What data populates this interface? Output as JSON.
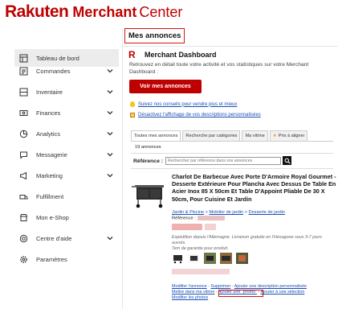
{
  "brand": {
    "rakuten": "Rakuten",
    "merchant": "Merchant",
    "center": "Center"
  },
  "sidebar": {
    "items": [
      {
        "label": "Tableau de bord",
        "icon": "dashboard-icon",
        "expandable": false,
        "active": true
      },
      {
        "label": "Commandes",
        "icon": "orders-icon",
        "expandable": true
      },
      {
        "label": "Inventaire",
        "icon": "inventory-icon",
        "expandable": true
      },
      {
        "label": "Finances",
        "icon": "finance-icon",
        "expandable": true
      },
      {
        "label": "Analytics",
        "icon": "analytics-icon",
        "expandable": true
      },
      {
        "label": "Messagerie",
        "icon": "message-icon",
        "expandable": true
      },
      {
        "label": "Marketing",
        "icon": "marketing-icon",
        "expandable": true
      },
      {
        "label": "Fulfillment",
        "icon": "fulfillment-icon",
        "expandable": false
      },
      {
        "label": "Mon e-Shop",
        "icon": "shop-icon",
        "expandable": false
      },
      {
        "label": "Centre d'aide",
        "icon": "help-icon",
        "expandable": true
      },
      {
        "label": "Paramètres",
        "icon": "settings-icon",
        "expandable": false
      }
    ]
  },
  "main": {
    "page_title": "Mes annonces",
    "dashboard_title": "Merchant Dashboard",
    "dashboard_description": "Retrouvez en détail toute votre activité et vos statistiques sur votre Merchant Dashboard :",
    "dashboard_button": "Voir mes annonces",
    "tips_link": "Suivez nos conseils pour vendre plus et mieux",
    "custom_desc_link": "Désactivez l'affichage de vos descriptions personnalisées",
    "tabs": [
      {
        "label": "Toutes mes annonces",
        "active": true
      },
      {
        "label": "Recherche par catégories"
      },
      {
        "label": "Ma vitrine"
      },
      {
        "label": "Prix à aligner",
        "icon": "star-icon"
      }
    ],
    "count_label": "19 annonces",
    "filter": {
      "label": "Référence :",
      "placeholder": "Rechercher par référence dans vos annonces"
    },
    "product": {
      "title": "Charlot De Barbecue Avec Porte D'Armoire Royal Gourmet - Desserte Extérieure Pour Plancha Avec Dessus De Table En Acier Inox 85 X 50cm Et Table D'Appoint Pliable De 30 X 50cm, Pour Cuisine Et Jardin",
      "category_1": "Jardin & Piscine",
      "category_2": "Mobilier de jardin",
      "category_3": "Desserte de jardin",
      "separator": ">",
      "reference_label": "Référence :",
      "shipping_line1": "Expédition depuis l'Allemagne. Livraison gratuite en l'Hexagone sous 3-7 jours ouvrés.",
      "shipping_line2": "Tem de garantie pour produit.",
      "actions": {
        "modify": "Modifier l'annonce",
        "delete": "Supprimer",
        "add_desc": "Ajouter une description personnalisée",
        "showcase": "Mettre dans ma vitrine",
        "promo": "Ajouter une \"promo\"",
        "selection": "Ajouter à une sélection",
        "photos": "Modifier les photos",
        "pipe": "-"
      }
    }
  },
  "colors": {
    "brand_red": "#bf0000",
    "highlight_box": "#d7140f",
    "link_blue": "#1a4fb5"
  }
}
